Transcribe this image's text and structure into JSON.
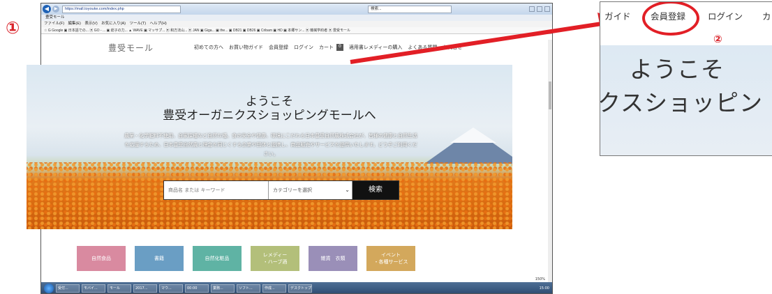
{
  "markers": {
    "one": "①",
    "two": "②"
  },
  "browser": {
    "url": "https://mall.toyouke.com/index.php",
    "search_box": "検索...",
    "tab_title": "豊受モール",
    "menu": "ファイル(F)　編集(E)　表示(V)　お気に入り(A)　ツール(T)　ヘルプ(H)",
    "favorites": "☆ G Google  ▣ 日本語での...  ▣ GO - ...  ▣ 総子の力...  ▲ WAVE  ▣ マッサプ...  ▣ 和方法山...  ▣ JAN  ▣ Giga...  ▣ the...  ▣ DB21  ▣ DB26  ▣ Cribam  ▣ HD  ▣ 本郷サン...  ▣ 機械学約者  ▣ 豊受モール",
    "zoom_level": "150%",
    "taskbar_items": [
      "受付...",
      "モバイ...",
      "モール",
      "2017...",
      "マウ...",
      "00:00",
      "",
      "業務...",
      "ソフト...",
      "作成...",
      "",
      "デスクトップ"
    ],
    "tray_time": "15:00"
  },
  "site": {
    "logo": "豊受モール",
    "nav": [
      "初めての方へ",
      "お買い物ガイド",
      "会員登録",
      "ログイン",
      "カート"
    ],
    "cart_count": "0",
    "nav_extra": [
      "適用書レメディーの購入",
      "よくある質問",
      "お問合せ"
    ],
    "hero_title_1": "ようこそ",
    "hero_title_2": "豊受オーガニクスショッピングモールへ",
    "hero_desc": "農薬・化学肥料不使用、自家採種など自然な種、食の安全や健康、環境にこだわる日本豊受自然農株式会社が、皆様の健康と自然生活を応援するため、日本豊受自然農と理念を同じくする企業や団体と提携し、商品販売やサービスを提供いたします。どうぞご利用ください。",
    "search_placeholder": "商品名 または キーワード",
    "category_select": "カテゴリーを選択",
    "search_button": "検索",
    "categories": [
      {
        "label": "自然食品",
        "color": "#d98aa0"
      },
      {
        "label": "書籍",
        "color": "#6a9ec4"
      },
      {
        "label": "自然化粧品",
        "color": "#5fb3a4"
      },
      {
        "label": "レメディー\n・ハーブ酒",
        "color": "#b3bf7a"
      },
      {
        "label": "雑貨　衣類",
        "color": "#9a8fb8"
      },
      {
        "label": "イベント\n・各種サービス",
        "color": "#d3a85c"
      }
    ]
  },
  "zoom_panel": {
    "nav": [
      "ガイド",
      "会員登録",
      "ログイン",
      "カ"
    ],
    "line1": "ようこそ",
    "line2": "クスショッピン"
  },
  "colors": {
    "highlight": "#e21f26"
  }
}
